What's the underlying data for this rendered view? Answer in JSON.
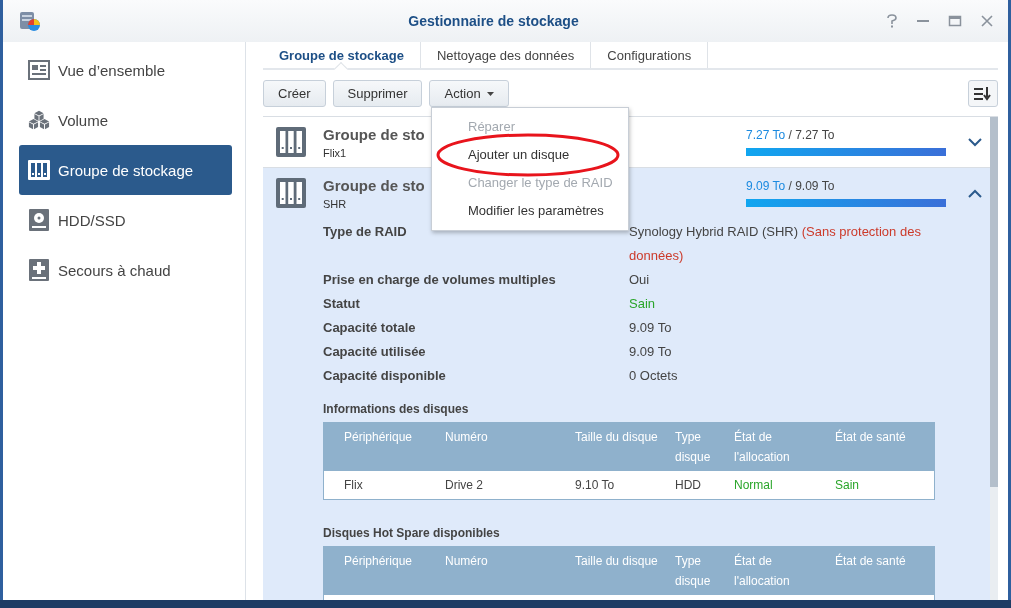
{
  "window": {
    "title": "Gestionnaire de stockage"
  },
  "sidebar": {
    "items": [
      {
        "label": "Vue d’ensemble",
        "selected": false
      },
      {
        "label": "Volume",
        "selected": false
      },
      {
        "label": "Groupe de stockage",
        "selected": true
      },
      {
        "label": "HDD/SSD",
        "selected": false
      },
      {
        "label": "Secours à chaud",
        "selected": false
      }
    ]
  },
  "tabs": [
    {
      "label": "Groupe de stockage",
      "selected": true
    },
    {
      "label": "Nettoyage des données",
      "selected": false
    },
    {
      "label": "Configurations",
      "selected": false
    }
  ],
  "toolbar": {
    "buttons": [
      {
        "label": "Créer",
        "dropdown": false
      },
      {
        "label": "Supprimer",
        "dropdown": false
      },
      {
        "label": "Action",
        "dropdown": true
      }
    ]
  },
  "action_menu": {
    "items": [
      {
        "label": "Réparer",
        "disabled": true,
        "circled": false
      },
      {
        "label": "Ajouter un disque",
        "disabled": false,
        "circled": true
      },
      {
        "label": "Changer le type de RAID",
        "disabled": true,
        "circled": false
      },
      {
        "label": "Modifier les paramètres",
        "disabled": false,
        "circled": false
      }
    ]
  },
  "pools": [
    {
      "title": "Groupe de sto",
      "subtitle": "Flix1",
      "used": "7.27 To",
      "total": "/ 7.27 To",
      "level": 1,
      "expanded": false
    },
    {
      "title": "Groupe de sto",
      "subtitle": "SHR",
      "used": "9.09 To",
      "total": "/ 9.09 To",
      "level": 1,
      "expanded": true,
      "details": [
        {
          "label": "Type de RAID",
          "value": "Synology Hybrid RAID (SHR)",
          "warning": "(Sans protection des données)",
          "kind": "plain"
        },
        {
          "label": "Prise en charge de volumes multiples",
          "value": "Oui",
          "kind": "plain"
        },
        {
          "label": "Statut",
          "value": "Sain",
          "kind": "good"
        },
        {
          "label": "Capacité totale",
          "value": "9.09 To",
          "kind": "plain"
        },
        {
          "label": "Capacité utilisée",
          "value": "9.09 To",
          "kind": "plain"
        },
        {
          "label": "Capacité disponible",
          "value": "0 Octets",
          "kind": "plain"
        }
      ],
      "tables": [
        {
          "title": "Informations des disques",
          "columns": [
            "Périphérique",
            "Numéro",
            "Taille du disque",
            "Type disque",
            "État de l'allocation",
            "État de santé"
          ],
          "rows": [
            [
              {
                "text": "Flix",
                "kind": "plain"
              },
              {
                "text": "Drive 2",
                "kind": "plain"
              },
              {
                "text": "9.10 To",
                "kind": "plain"
              },
              {
                "text": "HDD",
                "kind": "plain"
              },
              {
                "text": "Normal",
                "kind": "good"
              },
              {
                "text": "Sain",
                "kind": "good"
              }
            ]
          ]
        },
        {
          "title": "Disques Hot Spare disponibles",
          "columns": [
            "Périphérique",
            "Numéro",
            "Taille du disque",
            "Type disque",
            "État de l'allocation",
            "État de santé"
          ]
        }
      ]
    }
  ]
}
